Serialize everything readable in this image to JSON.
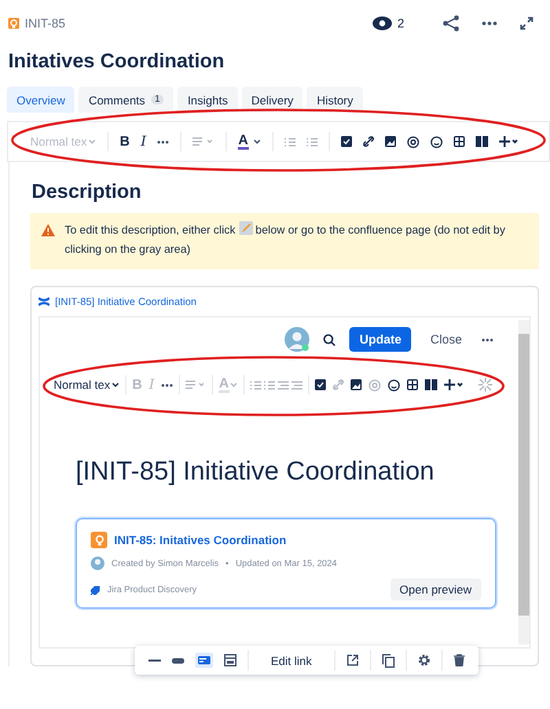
{
  "header": {
    "issue_key": "INIT-85",
    "watchers": "2"
  },
  "title": "Initatives Coordination",
  "tabs": [
    {
      "label": "Overview",
      "selected": true
    },
    {
      "label": "Comments",
      "count": "1",
      "selected": false
    },
    {
      "label": "Insights",
      "selected": false
    },
    {
      "label": "Delivery",
      "selected": false
    },
    {
      "label": "History",
      "selected": false
    }
  ],
  "editor_toolbar": {
    "style_label": "Normal tex",
    "style_disabled": true,
    "bold": "B",
    "italic": "I",
    "format_disabled": false,
    "text_color": "A"
  },
  "description": {
    "heading": "Description",
    "warning_before": "To edit this description, either click",
    "warning_after": "below or go to the confluence page (do not edit by clicking on the gray area)",
    "embed": {
      "link": "[INIT-85] Initiative Coordination",
      "update_button": "Update",
      "close_button": "Close",
      "toolbar": {
        "style_label": "Normal tex",
        "style_disabled": false,
        "bold": "B",
        "italic": "I",
        "format_disabled": true,
        "text_color": "A"
      },
      "page_heading": "[INIT-85] Initiative Coordination",
      "card": {
        "title": "INIT-85: Initatives Coordination",
        "created": "Created by Simon Marcelis",
        "separator": "•",
        "updated": "Updated on Mar 15, 2024",
        "source": "Jira Product Discovery",
        "button": "Open preview"
      },
      "link_toolbar": {
        "edit_link": "Edit link"
      }
    }
  }
}
